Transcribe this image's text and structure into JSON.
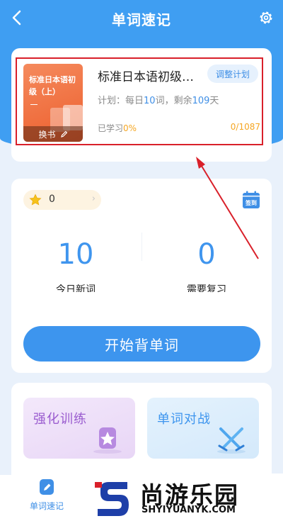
{
  "header": {
    "title": "单词速记",
    "back_icon": "chevron-left-icon",
    "settings_icon": "gear-icon"
  },
  "book": {
    "cover_title": "标准日本语初级（上）",
    "cover_dash": "—",
    "change_label": "换书",
    "name": "标准日本语初级（上）",
    "adjust_label": "调整计划",
    "plan_prefix": "计划：每日",
    "daily_words": "10",
    "plan_mid": "词，剩余",
    "days_left": "109",
    "plan_suffix": "天",
    "learned_prefix": "已学习",
    "learned_pct": "0%",
    "progress": "0/1087"
  },
  "stats": {
    "stars": "0",
    "signin_label": "签到",
    "new_words_num": "10",
    "new_words_label": "今日新词",
    "review_num": "0",
    "review_label": "需要复习",
    "start_label": "开始背单词"
  },
  "training": {
    "tile1_label": "强化训练",
    "tile2_label": "单词对战"
  },
  "nav": {
    "item_label": "单词速记"
  },
  "watermark": {
    "text": "尚游乐园",
    "url": "SHYIYUANYK.COM"
  },
  "colors": {
    "primary": "#3f9ef2",
    "accent_orange": "#f5a623",
    "annotation_red": "#d9202a"
  }
}
